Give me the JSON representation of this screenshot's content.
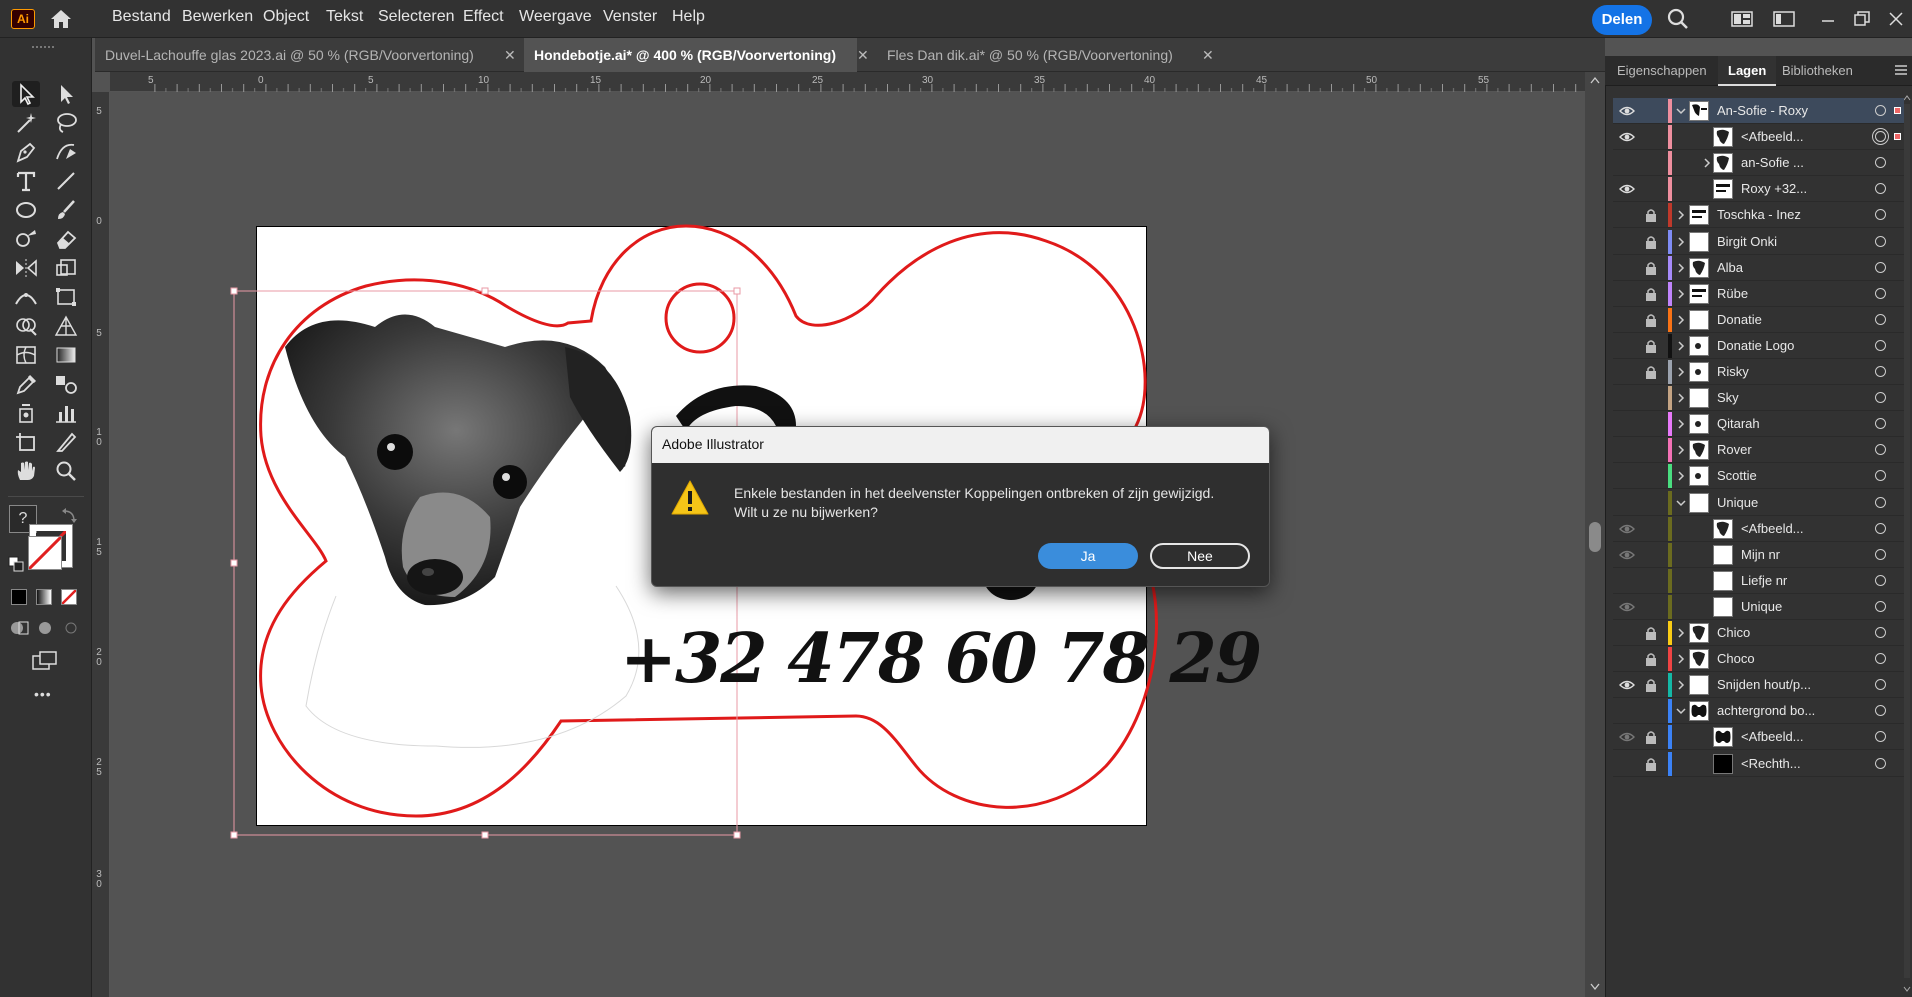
{
  "app": {
    "logo_text": "Ai"
  },
  "menu": [
    "Bestand",
    "Bewerken",
    "Object",
    "Tekst",
    "Selecteren",
    "Effect",
    "Weergave",
    "Venster",
    "Help"
  ],
  "share_label": "Delen",
  "tabs": [
    {
      "label": "Duvel-Lachouffe glas 2023.ai @ 50 % (RGB/Voorvertoning)",
      "active": false
    },
    {
      "label": "Hondebotje.ai* @ 400 % (RGB/Voorvertoning)",
      "active": true
    },
    {
      "label": "Fles Dan dik.ai* @ 50 % (RGB/Voorvertoning)",
      "active": false
    }
  ],
  "tab_close_glyph": "✕",
  "ruler_top": [
    "5",
    "0",
    "5",
    "10",
    "15",
    "20",
    "25",
    "30",
    "35",
    "40",
    "45",
    "50",
    "55"
  ],
  "ruler_left": [
    "5",
    "0",
    "5",
    "1 0",
    "1 5",
    "2 0",
    "2 5",
    "3 0"
  ],
  "toolbar_question": "?",
  "toolbar_more": "•••",
  "artboard": {
    "phone": "+32 478 60 78 29"
  },
  "panel": {
    "tabs": [
      "Eigenschappen",
      "Lagen",
      "Bibliotheken"
    ],
    "active_tab": "Lagen",
    "layers": [
      {
        "name": "An-Sofie - Roxy",
        "color": "#ef8f9f",
        "eye": true,
        "lock": false,
        "chevron": "down",
        "indent": 0,
        "selected": true,
        "thumb": "roxy"
      },
      {
        "name": "<Afbeeld...",
        "color": "#ef8f9f",
        "eye": true,
        "lock": false,
        "chevron": "none",
        "indent": 1,
        "selected": false,
        "thumb": "dog"
      },
      {
        "name": "an-Sofie ...",
        "color": "#ef8f9f",
        "eye": false,
        "lock": false,
        "chevron": "right",
        "indent": 1,
        "selected": false,
        "thumb": "dog"
      },
      {
        "name": "Roxy +32...",
        "color": "#ef8f9f",
        "eye": true,
        "lock": false,
        "chevron": "none",
        "indent": 1,
        "selected": false,
        "thumb": "text"
      },
      {
        "name": "Toschka - Inez",
        "color": "#c0392b",
        "eye": false,
        "lock": true,
        "chevron": "right",
        "indent": 0,
        "selected": false,
        "thumb": "text"
      },
      {
        "name": "Birgit Onki",
        "color": "#7f8cf5",
        "eye": false,
        "lock": true,
        "chevron": "right",
        "indent": 0,
        "selected": false,
        "thumb": "blank"
      },
      {
        "name": "Alba",
        "color": "#a78bfa",
        "eye": false,
        "lock": true,
        "chevron": "right",
        "indent": 0,
        "selected": false,
        "thumb": "dog"
      },
      {
        "name": "Rübe",
        "color": "#c084fc",
        "eye": false,
        "lock": true,
        "chevron": "right",
        "indent": 0,
        "selected": false,
        "thumb": "text"
      },
      {
        "name": "Donatie",
        "color": "#f97316",
        "eye": false,
        "lock": true,
        "chevron": "right",
        "indent": 0,
        "selected": false,
        "thumb": "blank"
      },
      {
        "name": "Donatie Logo",
        "color": "#111111",
        "eye": false,
        "lock": true,
        "chevron": "right",
        "indent": 0,
        "selected": false,
        "thumb": "dot"
      },
      {
        "name": "Risky",
        "color": "#9ca3af",
        "eye": false,
        "lock": true,
        "chevron": "right",
        "indent": 0,
        "selected": false,
        "thumb": "dot"
      },
      {
        "name": "Sky",
        "color": "#c4a484",
        "eye": false,
        "lock": false,
        "chevron": "right",
        "indent": 0,
        "selected": false,
        "thumb": "blank"
      },
      {
        "name": "Qitarah",
        "color": "#e879f9",
        "eye": false,
        "lock": false,
        "chevron": "right",
        "indent": 0,
        "selected": false,
        "thumb": "dot"
      },
      {
        "name": "Rover",
        "color": "#f472b6",
        "eye": false,
        "lock": false,
        "chevron": "right",
        "indent": 0,
        "selected": false,
        "thumb": "dog"
      },
      {
        "name": "Scottie",
        "color": "#4ade80",
        "eye": false,
        "lock": false,
        "chevron": "right",
        "indent": 0,
        "selected": false,
        "thumb": "dot"
      },
      {
        "name": "Unique",
        "color": "#6b6b1f",
        "eye": false,
        "lock": false,
        "chevron": "down",
        "indent": 0,
        "selected": false,
        "thumb": "blank"
      },
      {
        "name": "<Afbeeld...",
        "color": "#6b6b1f",
        "eye": true,
        "lock": false,
        "chevron": "none",
        "indent": 1,
        "selected": false,
        "thumb": "dog",
        "dim": true
      },
      {
        "name": "Mijn nr",
        "color": "#6b6b1f",
        "eye": true,
        "lock": false,
        "chevron": "none",
        "indent": 1,
        "selected": false,
        "thumb": "blank",
        "dim": true
      },
      {
        "name": "Liefje nr",
        "color": "#6b6b1f",
        "eye": false,
        "lock": false,
        "chevron": "none",
        "indent": 1,
        "selected": false,
        "thumb": "blank"
      },
      {
        "name": "Unique",
        "color": "#6b6b1f",
        "eye": true,
        "lock": false,
        "chevron": "none",
        "indent": 1,
        "selected": false,
        "thumb": "blank",
        "dim": true
      },
      {
        "name": "Chico",
        "color": "#facc15",
        "eye": false,
        "lock": true,
        "chevron": "right",
        "indent": 0,
        "selected": false,
        "thumb": "dog"
      },
      {
        "name": "Choco",
        "color": "#ef4444",
        "eye": false,
        "lock": true,
        "chevron": "right",
        "indent": 0,
        "selected": false,
        "thumb": "dog"
      },
      {
        "name": "Snijden hout/p...",
        "color": "#14b8a6",
        "eye": true,
        "lock": true,
        "chevron": "right",
        "indent": 0,
        "selected": false,
        "thumb": "blank"
      },
      {
        "name": "achtergrond bo...",
        "color": "#3b82f6",
        "eye": false,
        "lock": false,
        "chevron": "down",
        "indent": 0,
        "selected": false,
        "thumb": "bone"
      },
      {
        "name": "<Afbeeld...",
        "color": "#3b82f6",
        "eye": true,
        "lock": true,
        "chevron": "none",
        "indent": 1,
        "selected": false,
        "thumb": "bone",
        "dim": true
      },
      {
        "name": "<Rechth...",
        "color": "#3b82f6",
        "eye": false,
        "lock": true,
        "chevron": "none",
        "indent": 1,
        "selected": false,
        "thumb": "black"
      }
    ]
  },
  "dialog": {
    "title": "Adobe Illustrator",
    "line1": "Enkele bestanden in het deelvenster Koppelingen ontbreken of zijn gewijzigd.",
    "line2": "Wilt u ze nu bijwerken?",
    "yes": "Ja",
    "no": "Nee"
  },
  "colors": {
    "accent": "#1473e6",
    "cutline": "#e01a1a",
    "selection": "#e89aa6"
  }
}
